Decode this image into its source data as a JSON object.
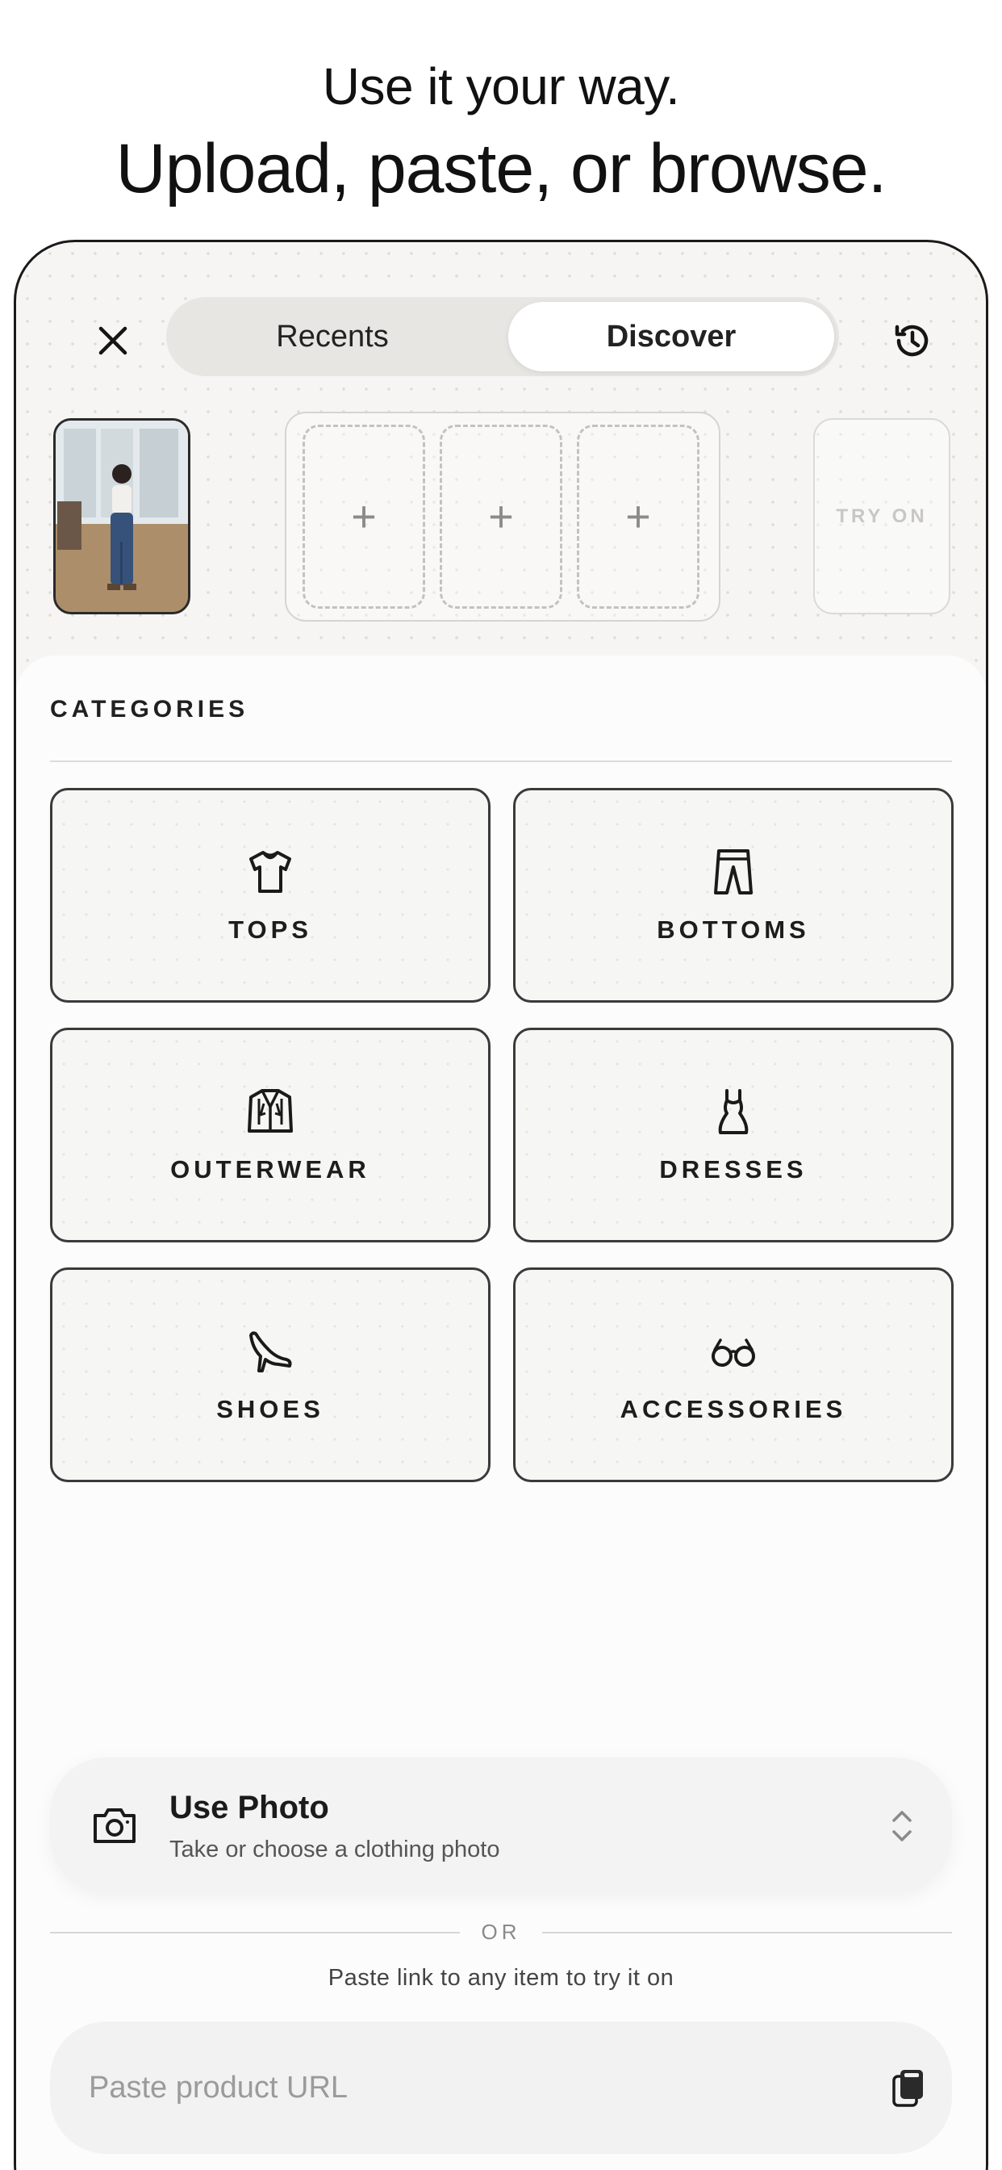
{
  "headline": {
    "line1": "Use it your way.",
    "line2": "Upload, paste, or browse."
  },
  "header": {
    "close_icon": "close-icon",
    "tabs": [
      {
        "label": "Recents",
        "selected": false
      },
      {
        "label": "Discover",
        "selected": true
      }
    ],
    "history_icon": "history-icon"
  },
  "outfit_builder": {
    "slot_symbol": "+",
    "try_on_label": "TRY ON"
  },
  "categories": {
    "title": "CATEGORIES",
    "items": [
      {
        "label": "TOPS",
        "icon": "shirt-icon"
      },
      {
        "label": "BOTTOMS",
        "icon": "pants-icon"
      },
      {
        "label": "OUTERWEAR",
        "icon": "jacket-icon"
      },
      {
        "label": "DRESSES",
        "icon": "dress-icon"
      },
      {
        "label": "SHOES",
        "icon": "heel-icon"
      },
      {
        "label": "ACCESSORIES",
        "icon": "glasses-icon"
      }
    ]
  },
  "use_photo": {
    "title": "Use Photo",
    "subtitle": "Take or choose a clothing photo",
    "icon": "camera-icon"
  },
  "divider": {
    "label": "OR"
  },
  "paste": {
    "hint": "Paste link to any item to try it on",
    "placeholder": "Paste product URL",
    "value": "",
    "icon": "clipboard-icon"
  }
}
